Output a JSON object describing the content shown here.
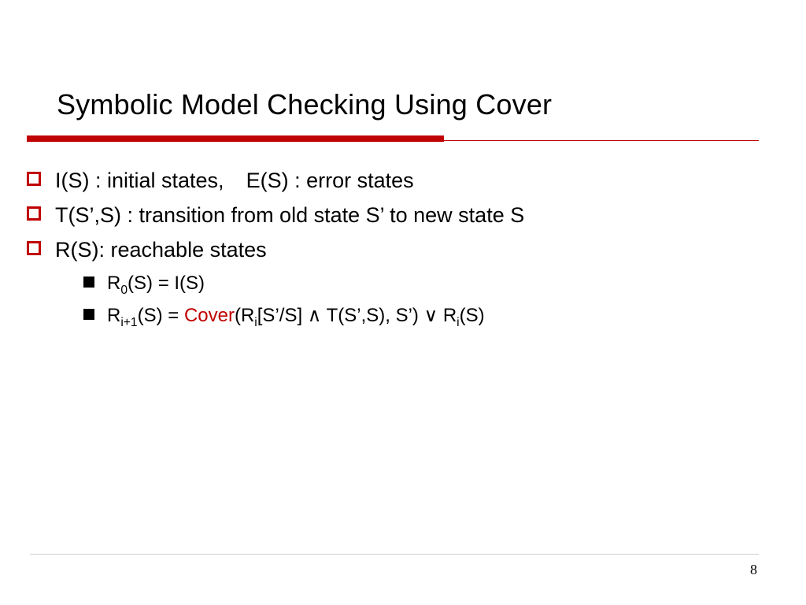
{
  "title": "Symbolic Model Checking Using Cover",
  "bullets": {
    "l1": [
      {
        "pre": "I(S) : initial states,",
        "post": "E(S) : error states"
      },
      {
        "text": "T(S’,S) : transition from old state S’ to new state S"
      },
      {
        "text": "R(S): reachable states"
      }
    ],
    "l2": [
      {
        "r_pre": "R",
        "r_sub": "0",
        "r_post": "(S) = I(S)"
      },
      {
        "r_pre": "R",
        "r_sub": "i+1",
        "r_mid1": "(S) = ",
        "cover": "Cover",
        "r_mid2": "(R",
        "r_sub2": "i",
        "r_mid3": "[S’/S] ∧ T(S’,S), S’) ∨ R",
        "r_sub3": "i",
        "r_post": "(S)"
      }
    ]
  },
  "page_number": "8",
  "colors": {
    "accent": "#c00000"
  }
}
